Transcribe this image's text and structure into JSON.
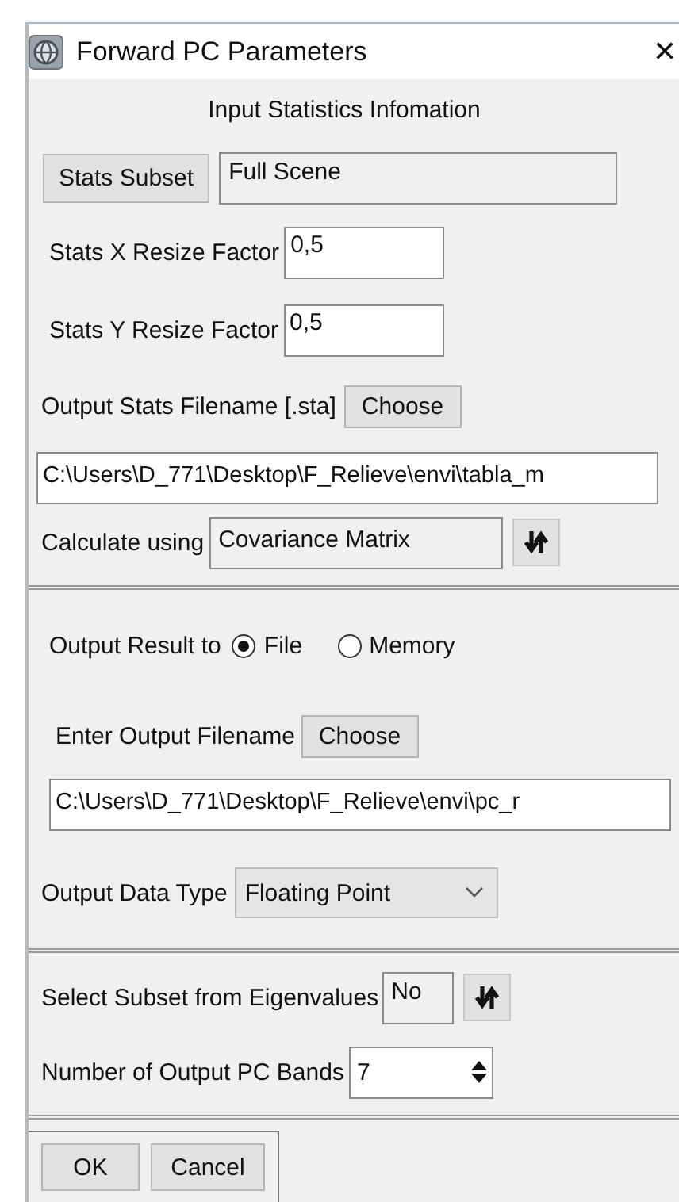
{
  "window": {
    "title": "Forward PC Parameters",
    "close": "×"
  },
  "input_stats": {
    "heading": "Input Statistics Infomation",
    "subset_button": "Stats Subset",
    "subset_value": "Full Scene",
    "x_resize": {
      "label": "Stats X Resize Factor",
      "value": "0,5"
    },
    "y_resize": {
      "label": "Stats Y Resize Factor",
      "value": "0,5"
    },
    "stats_file": {
      "label": "Output Stats Filename [.sta]",
      "button": "Choose",
      "value": "C:\\Users\\D_771\\Desktop\\F_Relieve\\envi\\tabla_m"
    },
    "calculate": {
      "label": "Calculate using",
      "value": "Covariance Matrix"
    }
  },
  "output": {
    "label": "Output Result to",
    "options": [
      {
        "label": "File",
        "selected": true
      },
      {
        "label": "Memory",
        "selected": false
      }
    ],
    "file_label": "Enter Output Filename",
    "button": "Choose",
    "file_value": "C:\\Users\\D_771\\Desktop\\F_Relieve\\envi\\pc_r",
    "data_type": {
      "label": "Output Data Type",
      "value": "Floating Point"
    }
  },
  "eigen": {
    "label": "Select Subset from Eigenvalues",
    "value": "No"
  },
  "bands": {
    "label": "Number of Output PC Bands",
    "value": "7"
  },
  "buttons": [
    "OK",
    "Cancel"
  ]
}
